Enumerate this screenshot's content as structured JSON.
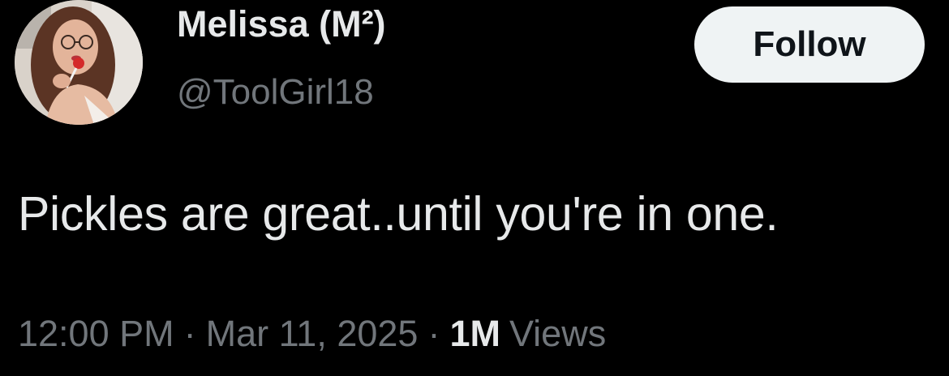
{
  "author": {
    "display_name": "Melissa (M²)",
    "handle": "@ToolGirl18",
    "avatar": "profile-photo"
  },
  "follow_button": {
    "label": "Follow"
  },
  "tweet": {
    "text": "Pickles are great..until you're in one."
  },
  "meta": {
    "time": "12:00 PM",
    "separator": "·",
    "date": "Mar 11, 2025",
    "views_count": "1M",
    "views_label": "Views"
  },
  "colors": {
    "background": "#000000",
    "primary_text": "#e7e9ea",
    "secondary_text": "#71767b",
    "button_background": "#eff3f4",
    "button_text": "#0f1419"
  }
}
